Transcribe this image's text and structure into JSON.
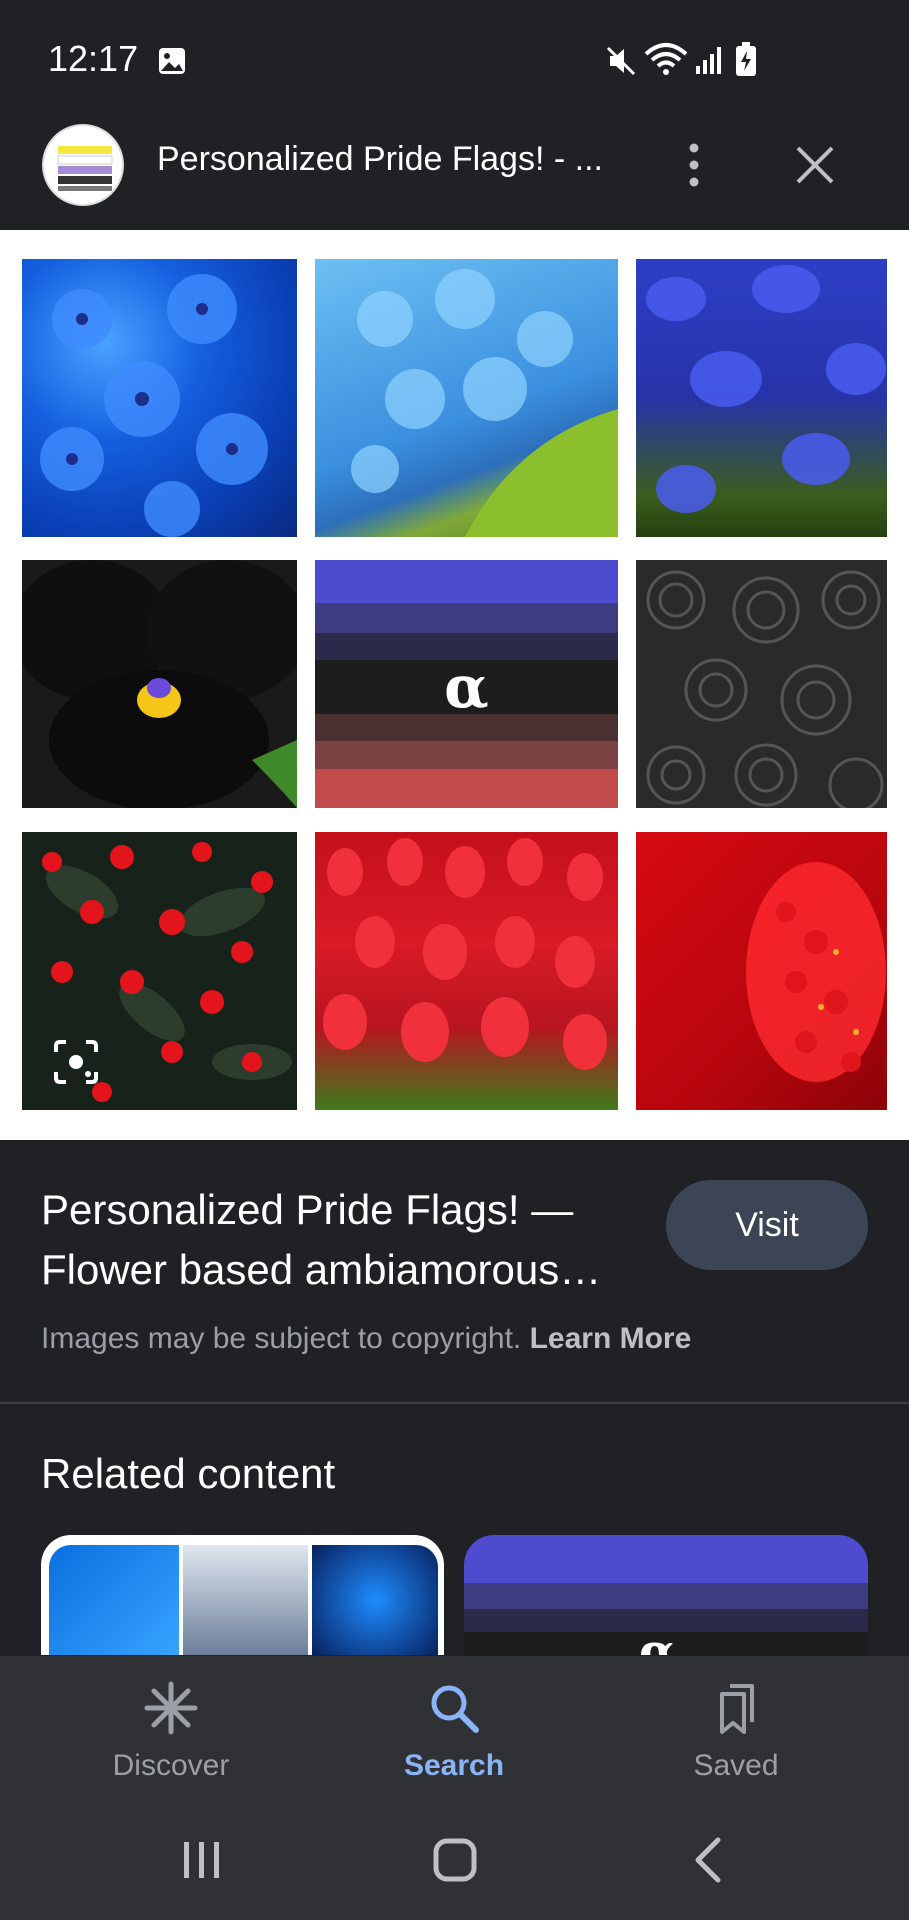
{
  "status_bar": {
    "time": "12:17",
    "icons": [
      "image-icon",
      "mute-icon",
      "wifi-icon",
      "signal-icon",
      "battery-charging-icon"
    ]
  },
  "header": {
    "title": "Personalized Pride Flags! - ...",
    "logo_icon": "site-logo"
  },
  "flag_tile": {
    "symbol": "α"
  },
  "source": {
    "title": "Personalized Pride Flags! — Flower based ambiamorous…",
    "visit_label": "Visit",
    "copyright_text": "Images may be subject to copyright. ",
    "learn_more": "Learn More"
  },
  "related": {
    "title": "Related content",
    "flag_symbol": "α"
  },
  "bottom_nav": {
    "items": [
      {
        "label": "Discover",
        "icon": "asterisk-icon"
      },
      {
        "label": "Search",
        "icon": "search-icon",
        "active": true
      },
      {
        "label": "Saved",
        "icon": "bookmark-icon"
      }
    ]
  },
  "system_nav": [
    "recents-icon",
    "home-icon",
    "back-icon"
  ],
  "colors": {
    "background": "#202124",
    "accent": "#8ab4f8",
    "visit_button": "#3c4556"
  }
}
